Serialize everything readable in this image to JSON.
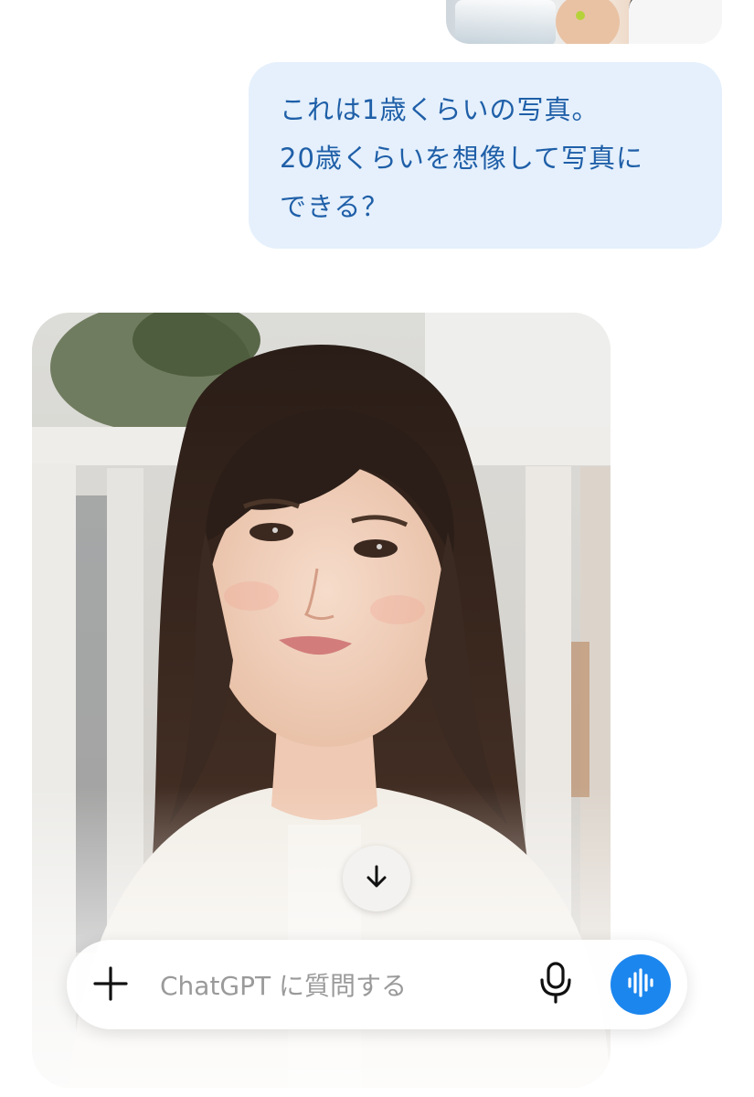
{
  "conversation": {
    "user_message": {
      "lines": [
        "これは1歳くらいの写真。",
        "20歳くらいを想像して写真に",
        "できる？"
      ]
    }
  },
  "composer": {
    "placeholder": "ChatGPT に質問する"
  },
  "icons": {
    "scroll": "arrow-down-icon",
    "attach": "plus-icon",
    "mic": "microphone-icon",
    "voice": "voice-mode-icon"
  },
  "colors": {
    "user_bubble_bg": "#e5f0fc",
    "user_bubble_text": "#1f5fa8",
    "voice_button": "#1b86ee"
  }
}
